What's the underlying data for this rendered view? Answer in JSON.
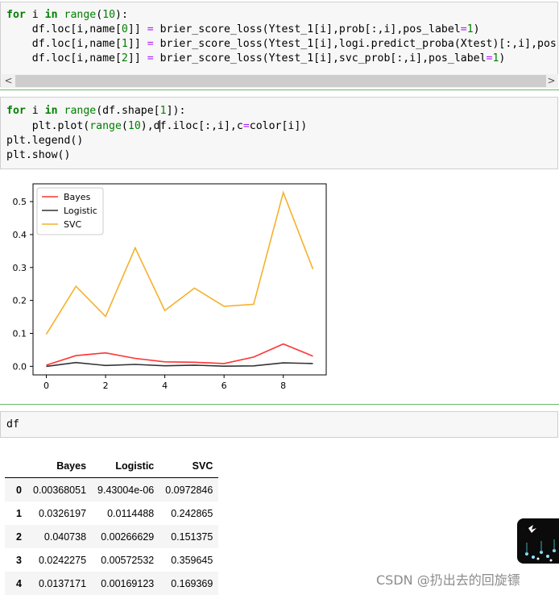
{
  "cell1": {
    "lines": [
      "for i in range(10):",
      "    df.loc[i,name[0]] = brier_score_loss(Ytest_1[i],prob[:,i],pos_label=1)",
      "    df.loc[i,name[1]] = brier_score_loss(Ytest_1[i],logi.predict_proba(Xtest)[:,i],pos",
      "    df.loc[i,name[2]] = brier_score_loss(Ytest_1[i],svc_prob[:,i],pos_label=1)"
    ],
    "scroll_left": "<",
    "scroll_right": ">"
  },
  "cell2": {
    "lines": [
      "for i in range(df.shape[1]):",
      "    plt.plot(range(10),df.iloc[:,i],c=color[i])",
      "plt.legend()",
      "plt.show()"
    ]
  },
  "cell3": {
    "code": "df"
  },
  "chart_data": {
    "type": "line",
    "x": [
      0,
      1,
      2,
      3,
      4,
      5,
      6,
      7,
      8,
      9
    ],
    "series": [
      {
        "name": "Bayes",
        "color": "#ff3333",
        "values": [
          0.0037,
          0.0326,
          0.0407,
          0.0242,
          0.0137,
          0.0125,
          0.0085,
          0.028,
          0.068,
          0.031
        ]
      },
      {
        "name": "Logistic",
        "color": "#333333",
        "values": [
          9.4e-06,
          0.0114,
          0.0027,
          0.0057,
          0.0017,
          0.0035,
          0.0004,
          0.0015,
          0.0105,
          0.0085
        ]
      },
      {
        "name": "SVC",
        "color": "#f6b02b",
        "values": [
          0.0973,
          0.2429,
          0.1514,
          0.3596,
          0.1694,
          0.2375,
          0.1822,
          0.1885,
          0.5275,
          0.295
        ]
      }
    ],
    "xticks": [
      "0",
      "2",
      "4",
      "6",
      "8"
    ],
    "yticks": [
      "0.0",
      "0.1",
      "0.2",
      "0.3",
      "0.4",
      "0.5"
    ],
    "xlim": [
      -0.45,
      9.45
    ],
    "ylim": [
      -0.026,
      0.554
    ],
    "legend": "upper-left",
    "grid": false
  },
  "table": {
    "columns": [
      "",
      "Bayes",
      "Logistic",
      "SVC"
    ],
    "rows": [
      [
        "0",
        "0.00368051",
        "9.43004e-06",
        "0.0972846"
      ],
      [
        "1",
        "0.0326197",
        "0.0114488",
        "0.242865"
      ],
      [
        "2",
        "0.040738",
        "0.00266629",
        "0.151375"
      ],
      [
        "3",
        "0.0242275",
        "0.00572532",
        "0.359645"
      ],
      [
        "4",
        "0.0137171",
        "0.00169123",
        "0.169369"
      ]
    ]
  },
  "watermark": "CSDN @扔出去的回旋镖"
}
